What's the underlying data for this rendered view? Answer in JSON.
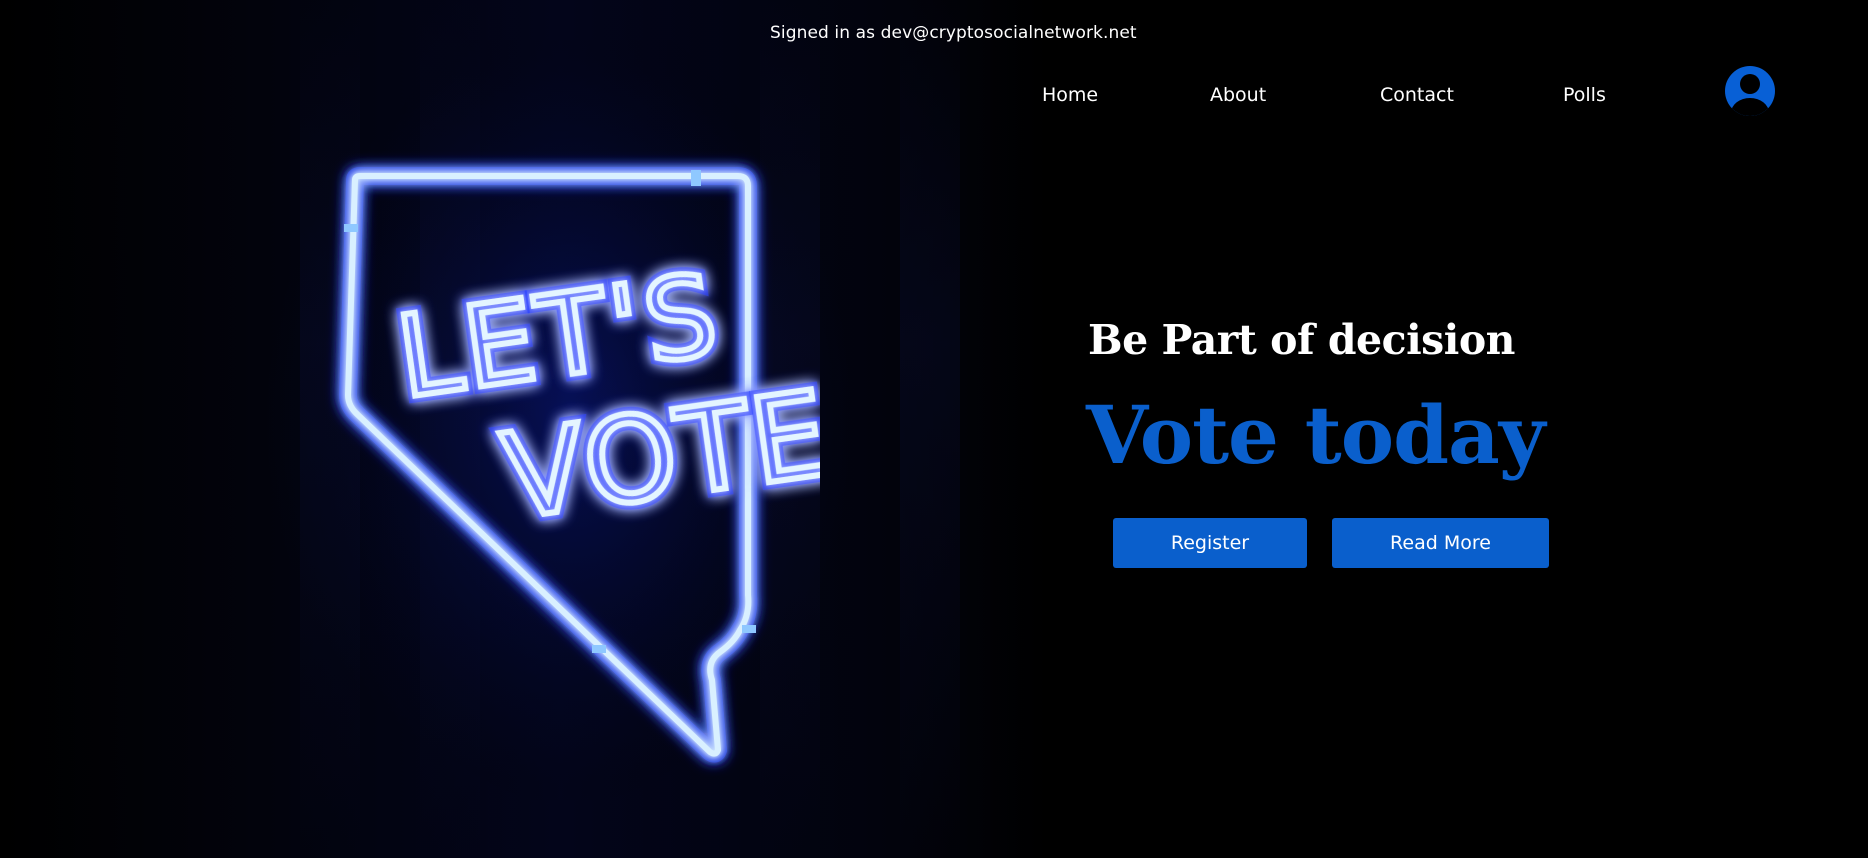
{
  "header": {
    "signed_in_text": "Signed in as dev@cryptosocialnetwork.net"
  },
  "nav": {
    "items": [
      {
        "label": "Home"
      },
      {
        "label": "About"
      },
      {
        "label": "Contact"
      },
      {
        "label": "Polls"
      }
    ],
    "avatar_icon": "user-circle-icon"
  },
  "hero": {
    "image_sign_text": [
      "LET'S",
      "VOTE"
    ],
    "subtitle": "Be Part of decision",
    "title": "Vote today",
    "buttons": {
      "register_label": "Register",
      "read_more_label": "Read More"
    }
  },
  "colors": {
    "background": "#000000",
    "accent": "#0a5fcc",
    "neon": "#bfe6ff",
    "text": "#ffffff"
  }
}
